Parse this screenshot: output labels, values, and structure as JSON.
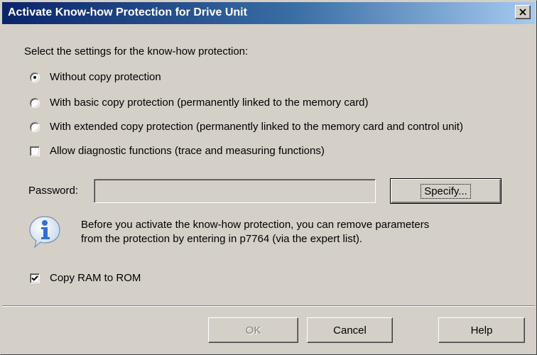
{
  "window": {
    "title": "Activate Know-how Protection for Drive Unit",
    "close_symbol": "×"
  },
  "settings": {
    "heading": "Select the settings for the know-how protection:",
    "options": [
      {
        "label": "Without copy protection",
        "selected": true
      },
      {
        "label": "With basic copy protection (permanently linked to the memory card)",
        "selected": false
      },
      {
        "label": "With extended copy protection (permanently linked to the memory card and control unit)",
        "selected": false
      }
    ],
    "diagnostic": {
      "label": "Allow diagnostic functions (trace and measuring functions)",
      "checked": false
    }
  },
  "password": {
    "label": "Password:",
    "value": "",
    "specify_label": "Specify..."
  },
  "info": {
    "icon": "info-icon",
    "line1": "Before you activate the know-how protection, you can remove parameters",
    "line2": "from the protection by entering in p7764 (via the expert list)."
  },
  "copy_ram": {
    "label": "Copy RAM to ROM",
    "checked": true
  },
  "buttons": {
    "ok": "OK",
    "cancel": "Cancel",
    "help": "Help"
  },
  "colors": {
    "title_start": "#0a246a",
    "title_end": "#a6caf0",
    "dialog_bg": "#d4d0c8",
    "info_icon": "#2f6fd6"
  }
}
